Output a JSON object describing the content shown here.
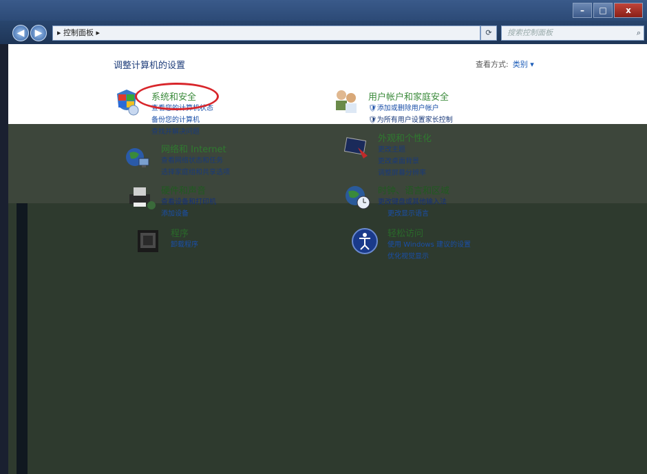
{
  "window": {
    "controls": {
      "minimize": "–",
      "maximize": "□",
      "close": "x"
    }
  },
  "addressbar": {
    "path": "▸ 控制面板 ▸",
    "search_placeholder": "搜索控制面板"
  },
  "main": {
    "title": "调整计算机的设置",
    "viewby_label": "查看方式:",
    "viewby_value": "类别 ▾"
  },
  "categories": {
    "system": {
      "title": "系统和安全",
      "links": [
        "查看您的计算机状态",
        "备份您的计算机",
        "查找并解决问题"
      ]
    },
    "network": {
      "title": "网络和 Internet",
      "links": [
        "查看网络状态和任务",
        "选择家庭组和共享选项"
      ]
    },
    "hardware": {
      "title": "硬件和声音",
      "links": [
        "查看设备和打印机",
        "添加设备"
      ]
    },
    "programs": {
      "title": "程序",
      "links": [
        "卸载程序"
      ]
    },
    "users": {
      "title": "用户帐户和家庭安全",
      "links": [
        "添加或删除用户帐户",
        "为所有用户设置家长控制"
      ]
    },
    "appearance": {
      "title": "外观和个性化",
      "links": [
        "更改主题",
        "更改桌面背景",
        "调整屏幕分辨率"
      ]
    },
    "clock": {
      "title": "时钟、语言和区域",
      "links": [
        "更改键盘或其他输入法",
        "更改显示语言"
      ]
    },
    "ease": {
      "title": "轻松访问",
      "links": [
        "使用 Windows 建议的设置",
        "优化视觉显示"
      ]
    }
  },
  "colors": {
    "link": "#1a4fa8",
    "heading": "#3a8a3a",
    "annotation": "#d8262b"
  }
}
